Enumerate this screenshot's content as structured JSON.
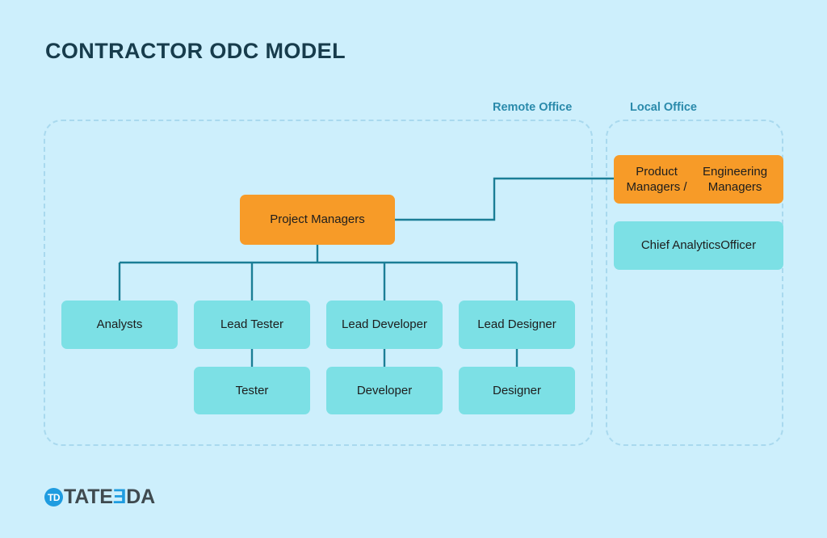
{
  "title": "CONTRACTOR ODC MODEL",
  "colors": {
    "background": "#cdeffc",
    "title_text": "#173c4c",
    "zone_label": "#2a8aab",
    "panel_border": "#a9d9ee",
    "node_teal": "#7ce0e5",
    "node_orange": "#f79b28",
    "connector": "#1b7e96",
    "logo_accent": "#1f9ce0"
  },
  "zones": {
    "remote": {
      "label": "Remote Office"
    },
    "local": {
      "label": "Local Office"
    }
  },
  "nodes": {
    "project_managers": "Project Managers",
    "analysts": "Analysts",
    "lead_tester": "Lead Tester",
    "lead_developer": "Lead Developer",
    "lead_designer": "Lead Designer",
    "tester": "Tester",
    "developer": "Developer",
    "designer": "Designer",
    "product_managers_line1": "Product Managers /",
    "product_managers_line2": "Engineering Managers",
    "chief_analytics_line1": "Chief Analytics",
    "chief_analytics_line2": "Officer"
  },
  "logo": {
    "badge": "TD",
    "text_part1": "TATE",
    "text_accent": "Ǝ",
    "text_part2": "DA"
  }
}
